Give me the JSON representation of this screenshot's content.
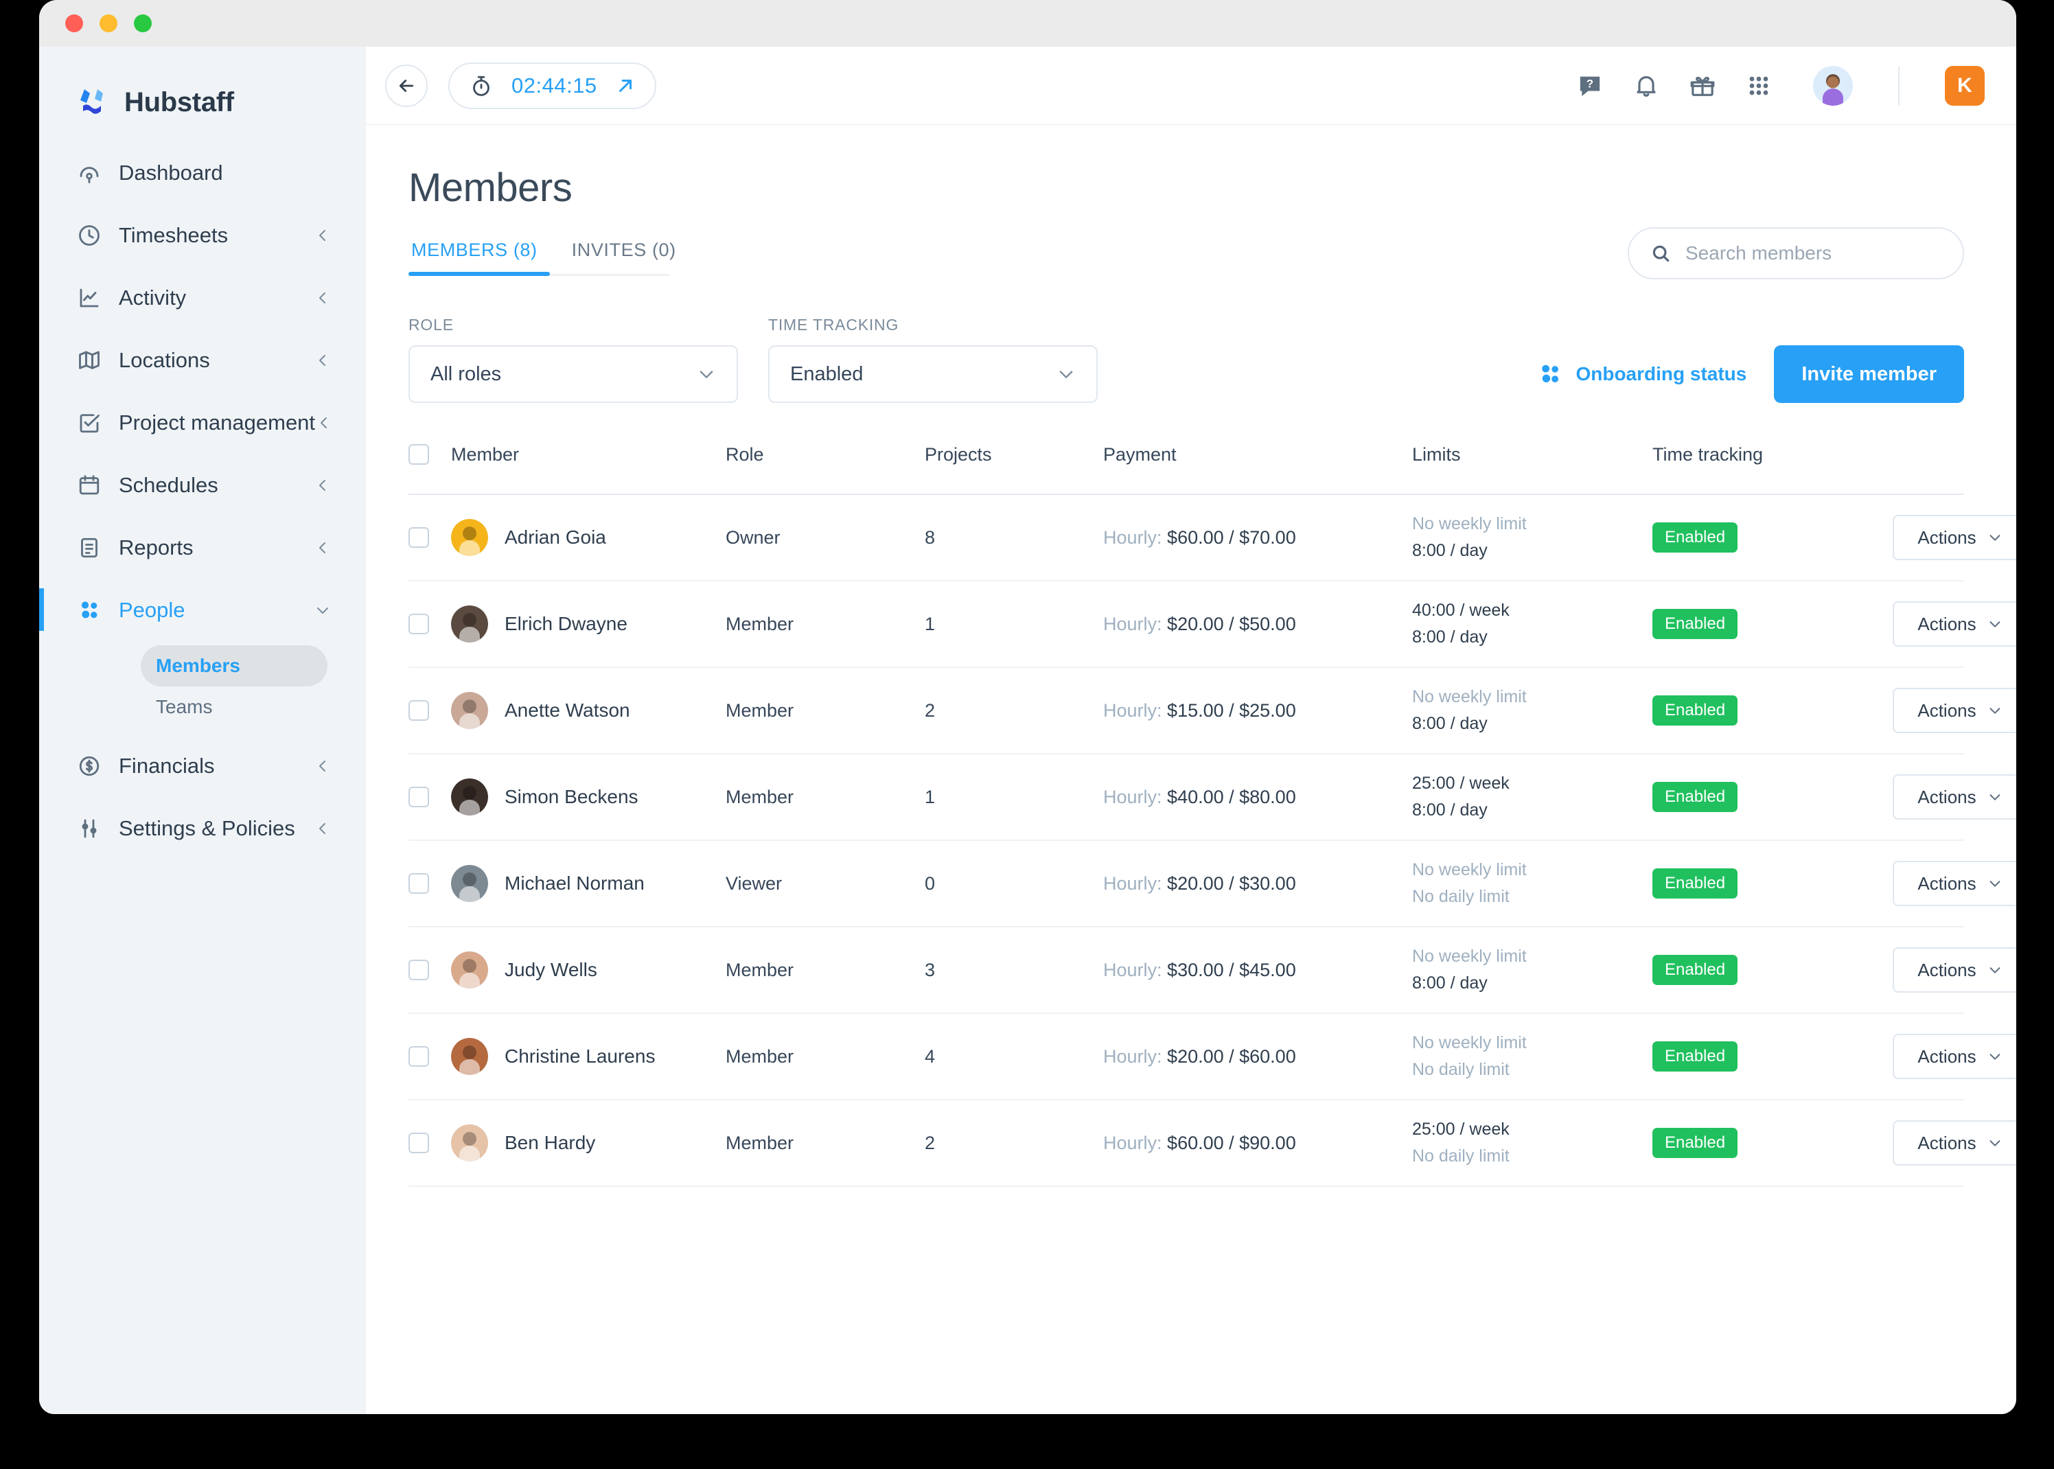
{
  "window": {
    "traffic_lights": [
      "close",
      "minimize",
      "maximize"
    ]
  },
  "sidebar": {
    "brand": "Hubstaff",
    "items": [
      {
        "label": "Dashboard",
        "icon": "dashboard-icon",
        "expandable": false,
        "active": false
      },
      {
        "label": "Timesheets",
        "icon": "clock-icon",
        "expandable": true,
        "active": false
      },
      {
        "label": "Activity",
        "icon": "chart-icon",
        "expandable": true,
        "active": false
      },
      {
        "label": "Locations",
        "icon": "map-icon",
        "expandable": true,
        "active": false
      },
      {
        "label": "Project management",
        "icon": "checkbox-icon",
        "expandable": true,
        "active": false
      },
      {
        "label": "Schedules",
        "icon": "calendar-icon",
        "expandable": true,
        "active": false
      },
      {
        "label": "Reports",
        "icon": "report-icon",
        "expandable": true,
        "active": false
      },
      {
        "label": "People",
        "icon": "people-icon",
        "expandable": true,
        "active": true
      },
      {
        "label": "Financials",
        "icon": "dollar-icon",
        "expandable": true,
        "active": false
      },
      {
        "label": "Settings & Policies",
        "icon": "sliders-icon",
        "expandable": true,
        "active": false
      }
    ],
    "subitems": [
      {
        "label": "Members",
        "active": true
      },
      {
        "label": "Teams",
        "active": false
      }
    ],
    "accent_color": "#27a0f5"
  },
  "topbar": {
    "back_icon": "arrow-left-icon",
    "timer": {
      "icon": "stopwatch-icon",
      "value": "02:44:15",
      "expand_icon": "arrow-up-right-icon"
    },
    "icons": [
      {
        "name": "help-icon"
      },
      {
        "name": "bell-icon"
      },
      {
        "name": "gift-icon"
      },
      {
        "name": "grid-apps-icon"
      }
    ],
    "avatar": "user-avatar",
    "account_badge": "K",
    "account_badge_color": "#f58220"
  },
  "page": {
    "title": "Members",
    "tabs": [
      {
        "label": "MEMBERS (8)",
        "active": true
      },
      {
        "label": "INVITES (0)",
        "active": false
      }
    ],
    "search": {
      "placeholder": "Search members",
      "value": "",
      "icon": "search-icon"
    }
  },
  "filters": {
    "role": {
      "label": "ROLE",
      "value": "All roles",
      "chevron": "chevron-down-icon"
    },
    "time_tracking": {
      "label": "TIME TRACKING",
      "value": "Enabled",
      "chevron": "chevron-down-icon"
    },
    "onboarding_status": {
      "label": "Onboarding status",
      "icon": "people-icon"
    },
    "invite_button": {
      "label": "Invite member",
      "color": "#27a0f5"
    }
  },
  "table": {
    "columns": [
      "Member",
      "Role",
      "Projects",
      "Payment",
      "Limits",
      "Time tracking"
    ],
    "payment_prefix": "Hourly:",
    "actions_label": "Actions",
    "rows": [
      {
        "name": "Adrian Goia",
        "role": "Owner",
        "projects": "8",
        "payment": "$60.00 / $70.00",
        "weekly_limit": "No weekly limit",
        "weekly_set": false,
        "daily_limit": "8:00 / day",
        "daily_set": true,
        "tracking": "Enabled",
        "avatar_bg": "#f5b51a"
      },
      {
        "name": "Elrich Dwayne",
        "role": "Member",
        "projects": "1",
        "payment": "$20.00 / $50.00",
        "weekly_limit": "40:00 / week",
        "weekly_set": true,
        "daily_limit": "8:00 / day",
        "daily_set": true,
        "tracking": "Enabled",
        "avatar_bg": "#5b4a3f"
      },
      {
        "name": "Anette Watson",
        "role": "Member",
        "projects": "2",
        "payment": "$15.00 / $25.00",
        "weekly_limit": "No weekly limit",
        "weekly_set": false,
        "daily_limit": "8:00 / day",
        "daily_set": true,
        "tracking": "Enabled",
        "avatar_bg": "#c9a898"
      },
      {
        "name": "Simon Beckens",
        "role": "Member",
        "projects": "1",
        "payment": "$40.00 / $80.00",
        "weekly_limit": "25:00 / week",
        "weekly_set": true,
        "daily_limit": "8:00 / day",
        "daily_set": true,
        "tracking": "Enabled",
        "avatar_bg": "#3b2f2a"
      },
      {
        "name": "Michael Norman",
        "role": "Viewer",
        "projects": "0",
        "payment": "$20.00 / $30.00",
        "weekly_limit": "No weekly limit",
        "weekly_set": false,
        "daily_limit": "No daily limit",
        "daily_set": false,
        "tracking": "Enabled",
        "avatar_bg": "#7d8a93"
      },
      {
        "name": "Judy Wells",
        "role": "Member",
        "projects": "3",
        "payment": "$30.00 / $45.00",
        "weekly_limit": "No weekly limit",
        "weekly_set": false,
        "daily_limit": "8:00 / day",
        "daily_set": true,
        "tracking": "Enabled",
        "avatar_bg": "#d9a98c"
      },
      {
        "name": "Christine Laurens",
        "role": "Member",
        "projects": "4",
        "payment": "$20.00 / $60.00",
        "weekly_limit": "No weekly limit",
        "weekly_set": false,
        "daily_limit": "No daily limit",
        "daily_set": false,
        "tracking": "Enabled",
        "avatar_bg": "#b5693f"
      },
      {
        "name": "Ben Hardy",
        "role": "Member",
        "projects": "2",
        "payment": "$60.00 / $90.00",
        "weekly_limit": "25:00 / week",
        "weekly_set": true,
        "daily_limit": "No daily limit",
        "daily_set": false,
        "tracking": "Enabled",
        "avatar_bg": "#e6c3a8"
      }
    ]
  },
  "colors": {
    "accent": "#27a0f5",
    "success": "#20c05e",
    "sidebar_bg": "#f0f4f7",
    "muted_text": "#9fb0c0"
  }
}
